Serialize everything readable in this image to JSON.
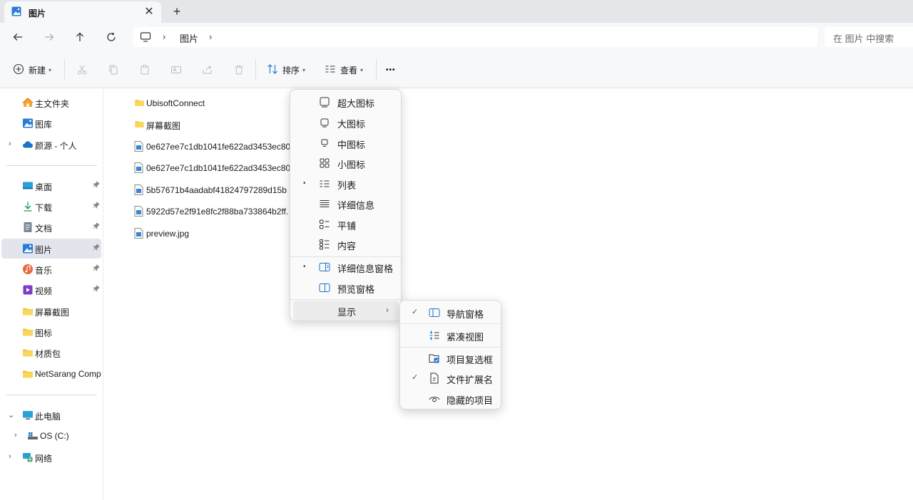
{
  "tab": {
    "title": "图片",
    "close": "✕",
    "new_tab": "+"
  },
  "address": {
    "sep": "›",
    "crumb": "图片"
  },
  "search": {
    "placeholder": "在 图片 中搜索"
  },
  "toolbar": {
    "new_label": "新建",
    "sort_label": "排序",
    "view_label": "查看",
    "more": "•••"
  },
  "sidebar": {
    "top": [
      {
        "label": "主文件夹",
        "icon": "home-icon"
      },
      {
        "label": "图库",
        "icon": "gallery-icon"
      },
      {
        "label": "颜源 - 个人",
        "icon": "cloud-icon"
      }
    ],
    "quick": [
      {
        "label": "桌面",
        "icon": "desktop-icon",
        "pinned": true
      },
      {
        "label": "下载",
        "icon": "download-icon",
        "pinned": true
      },
      {
        "label": "文档",
        "icon": "document-icon",
        "pinned": true
      },
      {
        "label": "图片",
        "icon": "pictures-icon",
        "pinned": true
      },
      {
        "label": "音乐",
        "icon": "music-icon",
        "pinned": true
      },
      {
        "label": "视频",
        "icon": "video-icon",
        "pinned": true
      },
      {
        "label": "屏幕截图",
        "icon": "folder-icon",
        "pinned": false
      },
      {
        "label": "图标",
        "icon": "folder-icon",
        "pinned": false
      },
      {
        "label": "材质包",
        "icon": "folder-icon",
        "pinned": false
      },
      {
        "label": "NetSarang Compu",
        "icon": "folder-icon",
        "pinned": false
      }
    ],
    "bottom": [
      {
        "label": "此电脑",
        "icon": "computer-icon"
      },
      {
        "label": "OS (C:)",
        "icon": "drive-icon"
      },
      {
        "label": "网络",
        "icon": "network-icon"
      }
    ],
    "pin_glyph": "📌"
  },
  "files": [
    {
      "name": "UbisoftConnect",
      "type": "folder"
    },
    {
      "name": "屏幕截图",
      "type": "folder"
    },
    {
      "name": "0e627ee7c1db1041fe622ad3453ec80",
      "type": "image"
    },
    {
      "name": "0e627ee7c1db1041fe622ad3453ec80",
      "type": "image"
    },
    {
      "name": "5b57671b4aadabf41824797289d15b",
      "type": "image"
    },
    {
      "name": "5922d57e2f91e8fc2f88ba733864b2ff.",
      "type": "image"
    },
    {
      "name": "preview.jpg",
      "type": "image"
    }
  ],
  "view_menu": {
    "items": [
      {
        "label": "超大图标",
        "icon": "extra-large-icons-icon",
        "selected": false
      },
      {
        "label": "大图标",
        "icon": "large-icons-icon",
        "selected": false
      },
      {
        "label": "中图标",
        "icon": "medium-icons-icon",
        "selected": false
      },
      {
        "label": "小图标",
        "icon": "small-icons-icon",
        "selected": false
      },
      {
        "label": "列表",
        "icon": "list-icon",
        "selected": true
      },
      {
        "label": "详细信息",
        "icon": "details-icon",
        "selected": false
      },
      {
        "label": "平铺",
        "icon": "tiles-icon",
        "selected": false
      },
      {
        "label": "内容",
        "icon": "content-icon",
        "selected": false
      }
    ],
    "panes": [
      {
        "label": "详细信息窗格",
        "icon": "details-pane-icon",
        "selected": true
      },
      {
        "label": "预览窗格",
        "icon": "preview-pane-icon",
        "selected": false
      }
    ],
    "show": {
      "label": "显示",
      "arrow": "›"
    },
    "bullet": "•"
  },
  "show_menu": {
    "items": [
      {
        "label": "导航窗格",
        "icon": "navigation-pane-icon",
        "checked": true
      },
      {
        "label": "紧凑视图",
        "icon": "compact-view-icon",
        "checked": false
      },
      {
        "label": "项目复选框",
        "icon": "item-checkbox-icon",
        "checked": false
      },
      {
        "label": "文件扩展名",
        "icon": "file-extension-icon",
        "checked": true
      },
      {
        "label": "隐藏的项目",
        "icon": "hidden-items-icon",
        "checked": false
      }
    ],
    "check": "✓"
  },
  "colors": {
    "accent": "#1a73c9",
    "folder": "#f4c542",
    "selected_bg": "#e2e6ec",
    "hover_bg": "#ececec"
  }
}
